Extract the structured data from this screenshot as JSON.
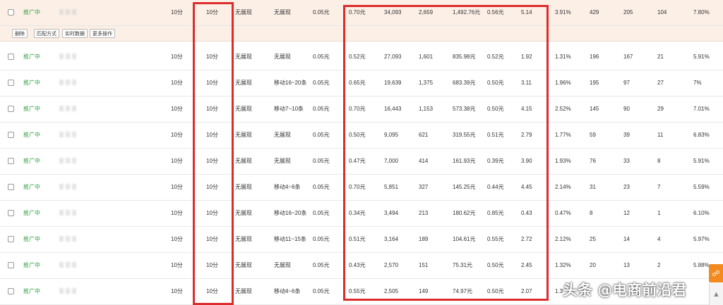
{
  "actions": {
    "delete": "删除",
    "match_type": "匹配方式",
    "realtime": "实时数据",
    "more": "更多操作"
  },
  "rows": [
    {
      "status": "推广中",
      "quality1": "10分",
      "quality2": "10分",
      "pc_rank": "无展现",
      "mobile_rank": "无展现",
      "bid": "0.05元",
      "avg_cpc": "0.70元",
      "impressions": "34,093",
      "clicks": "2,659",
      "cost": "1,492.76元",
      "ppc": "0.56元",
      "roi": "5.14",
      "ctr": "3.91%",
      "c13": "429",
      "c14": "205",
      "c15": "104",
      "cvr": "7.80%"
    },
    {
      "status": "推广中",
      "quality1": "10分",
      "quality2": "10分",
      "pc_rank": "无展现",
      "mobile_rank": "无展现",
      "bid": "0.05元",
      "avg_cpc": "0.52元",
      "impressions": "27,093",
      "clicks": "1,601",
      "cost": "835.98元",
      "ppc": "0.52元",
      "roi": "1.92",
      "ctr": "1.31%",
      "c13": "196",
      "c14": "167",
      "c15": "21",
      "cvr": "5.91%"
    },
    {
      "status": "推广中",
      "quality1": "10分",
      "quality2": "10分",
      "pc_rank": "无展现",
      "mobile_rank": "移动16~20条",
      "bid": "0.05元",
      "avg_cpc": "0.65元",
      "impressions": "19,639",
      "clicks": "1,375",
      "cost": "683.39元",
      "ppc": "0.50元",
      "roi": "3.11",
      "ctr": "1.96%",
      "c13": "195",
      "c14": "97",
      "c15": "27",
      "cvr": "7%"
    },
    {
      "status": "推广中",
      "quality1": "10分",
      "quality2": "10分",
      "pc_rank": "无展现",
      "mobile_rank": "移动7~10条",
      "bid": "0.05元",
      "avg_cpc": "0.70元",
      "impressions": "16,443",
      "clicks": "1,153",
      "cost": "573.38元",
      "ppc": "0.50元",
      "roi": "4.15",
      "ctr": "2.52%",
      "c13": "145",
      "c14": "90",
      "c15": "29",
      "cvr": "7.01%"
    },
    {
      "status": "推广中",
      "quality1": "10分",
      "quality2": "10分",
      "pc_rank": "无展现",
      "mobile_rank": "无展现",
      "bid": "0.05元",
      "avg_cpc": "0.50元",
      "impressions": "9,095",
      "clicks": "621",
      "cost": "319.55元",
      "ppc": "0.51元",
      "roi": "2.79",
      "ctr": "1.77%",
      "c13": "59",
      "c14": "39",
      "c15": "11",
      "cvr": "6.83%"
    },
    {
      "status": "推广中",
      "quality1": "10分",
      "quality2": "10分",
      "pc_rank": "无展现",
      "mobile_rank": "无展现",
      "bid": "0.05元",
      "avg_cpc": "0.47元",
      "impressions": "7,000",
      "clicks": "414",
      "cost": "161.93元",
      "ppc": "0.39元",
      "roi": "3.90",
      "ctr": "1.93%",
      "c13": "76",
      "c14": "33",
      "c15": "8",
      "cvr": "5.91%"
    },
    {
      "status": "推广中",
      "quality1": "10分",
      "quality2": "10分",
      "pc_rank": "无展现",
      "mobile_rank": "移动4~6条",
      "bid": "0.05元",
      "avg_cpc": "0.70元",
      "impressions": "5,851",
      "clicks": "327",
      "cost": "145.25元",
      "ppc": "0.44元",
      "roi": "4.45",
      "ctr": "2.14%",
      "c13": "31",
      "c14": "23",
      "c15": "7",
      "cvr": "5.59%"
    },
    {
      "status": "推广中",
      "quality1": "10分",
      "quality2": "10分",
      "pc_rank": "无展现",
      "mobile_rank": "移动16~20条",
      "bid": "0.05元",
      "avg_cpc": "0.34元",
      "impressions": "3,494",
      "clicks": "213",
      "cost": "180.62元",
      "ppc": "0.85元",
      "roi": "0.43",
      "ctr": "0.47%",
      "c13": "8",
      "c14": "12",
      "c15": "1",
      "cvr": "6.10%"
    },
    {
      "status": "推广中",
      "quality1": "10分",
      "quality2": "10分",
      "pc_rank": "无展现",
      "mobile_rank": "移动11~15条",
      "bid": "0.05元",
      "avg_cpc": "0.51元",
      "impressions": "3,164",
      "clicks": "189",
      "cost": "104.61元",
      "ppc": "0.55元",
      "roi": "2.72",
      "ctr": "2.12%",
      "c13": "25",
      "c14": "14",
      "c15": "4",
      "cvr": "5.97%"
    },
    {
      "status": "推广中",
      "quality1": "10分",
      "quality2": "10分",
      "pc_rank": "无展现",
      "mobile_rank": "无展现",
      "bid": "0.05元",
      "avg_cpc": "0.43元",
      "impressions": "2,570",
      "clicks": "151",
      "cost": "75.31元",
      "ppc": "0.50元",
      "roi": "2.45",
      "ctr": "1.32%",
      "c13": "20",
      "c14": "13",
      "c15": "2",
      "cvr": "5.88%"
    },
    {
      "status": "推广中",
      "quality1": "10分",
      "quality2": "10分",
      "pc_rank": "无展现",
      "mobile_rank": "移动4~6条",
      "bid": "0.05元",
      "avg_cpc": "0.55元",
      "impressions": "2,505",
      "clicks": "149",
      "cost": "74.97元",
      "ppc": "0.50元",
      "roi": "2.07",
      "ctr": "1.3",
      "c13": "",
      "c14": "",
      "c15": "",
      "cvr": ""
    }
  ],
  "watermark": "头条 @电商前沿君",
  "colors": {
    "status_green": "#3ba34a",
    "highlight_red": "#dd2c2c",
    "selected_row_bg": "#fcefe6",
    "side_tab_orange": "#f28a1f"
  },
  "side_icons": {
    "tab": "bookmark-icon",
    "top": "arrow-up-icon"
  }
}
